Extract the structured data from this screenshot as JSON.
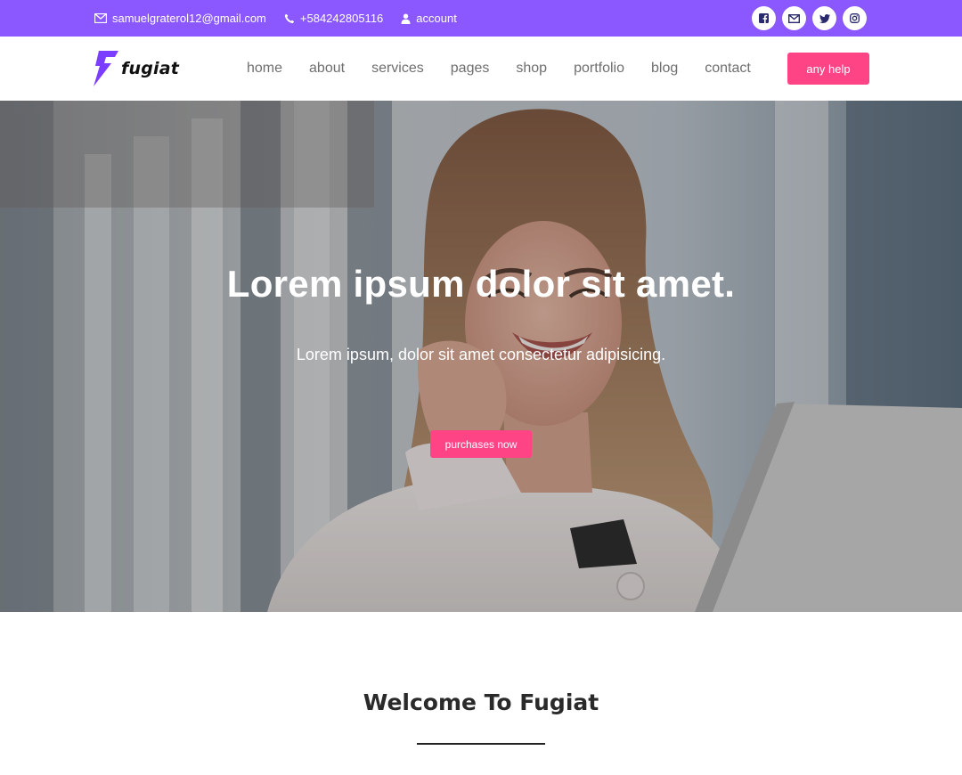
{
  "topbar": {
    "email": "samuelgraterol12@gmail.com",
    "phone": "+584242805116",
    "account": "account",
    "socials": [
      "facebook-icon",
      "mail-icon",
      "twitter-icon",
      "instagram-icon"
    ]
  },
  "brand": {
    "name": "fugiat"
  },
  "nav": {
    "items": [
      "home",
      "about",
      "services",
      "pages",
      "shop",
      "portfolio",
      "blog",
      "contact"
    ],
    "help_label": "any help"
  },
  "hero": {
    "title": "Lorem ipsum dolor sit amet.",
    "subtitle": "Lorem ipsum, dolor sit amet consectetur adipisicing.",
    "button_label": "purchases now"
  },
  "welcome": {
    "title": "Welcome To Fugiat"
  },
  "colors": {
    "topbar": "#8b57ff",
    "accent": "#ff4486",
    "brand_bolt": "#7b3dff"
  }
}
